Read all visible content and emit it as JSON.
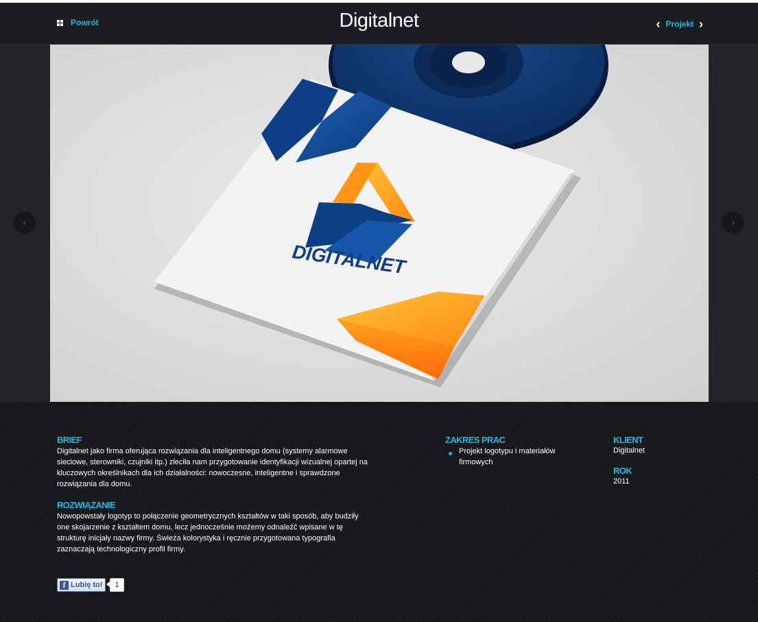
{
  "header": {
    "back_label": "Powrót",
    "site_title": "Digitalnet",
    "project_nav_label": "Projekt"
  },
  "hero": {
    "logo_text": "DIGITALNET",
    "prev_icon": "chevron-left-icon",
    "next_icon": "chevron-right-icon"
  },
  "info": {
    "brief_heading": "BRIEF",
    "brief_text": "Digitalnet jako firma oferująca rozwiązania dla inteligentnego domu (systemy alarmowe sieciowe, sterowniki, czujniki itp.) zleciła nam przygotowanie identyfikacji wizualnej opartej na kluczowych określnikach dla ich działalności: nowoczesne, inteligentne i sprawdzone rozwiązania dla domu.",
    "solution_heading": "ROZWIĄZANIE",
    "solution_text": "Nowopowstały logotyp to połączenie geometrycznych kształtów w taki sposób, aby budziły one skojarzenie z kształtem domu, lecz jednocześnie możemy odnaleźć wpisane w tę strukturę inicjały nazwy firmy. Świeża kolorystyka i ręcznie przygotowana typografia zaznaczają technologiczny profil firmy.",
    "scope_heading": "ZAKRES PRAC",
    "scope_items": [
      "Projekt logotypu i materiałów firmowych"
    ],
    "client_heading": "KLIENT",
    "client_value": "Digitalnet",
    "year_heading": "ROK",
    "year_value": "2011"
  },
  "social": {
    "like_label": "Lubię to!",
    "like_count": "1"
  },
  "colors": {
    "accent": "#20b9e0",
    "dark_bg": "#1b1d20",
    "brand_blue": "#0d3f85",
    "brand_orange": "#ff8a12"
  }
}
